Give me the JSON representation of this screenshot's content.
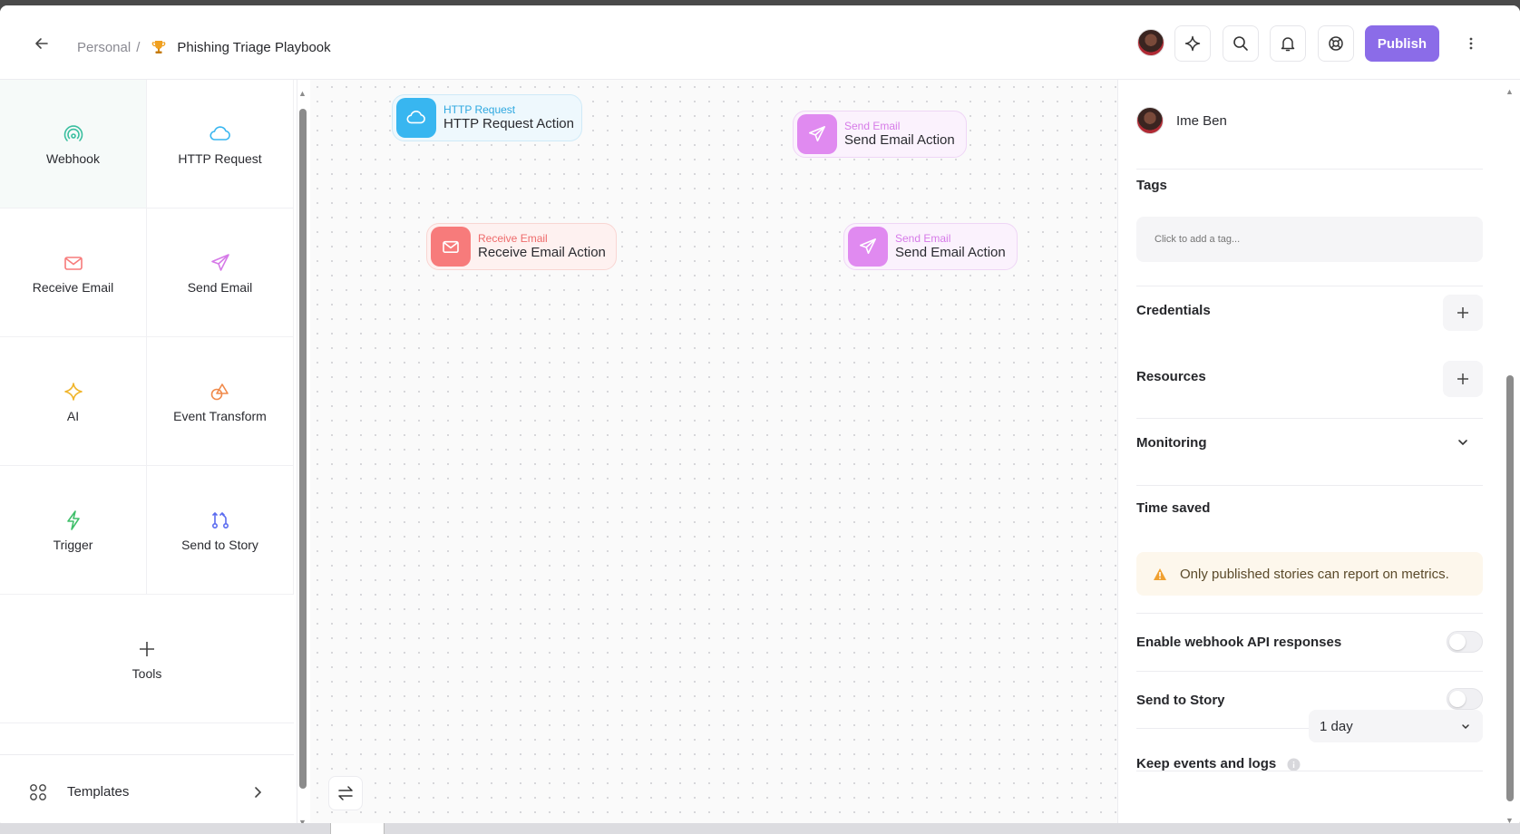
{
  "topbar": {
    "breadcrumb_root": "Personal",
    "breadcrumb_sep": "/",
    "story_title": "Phishing Triage Playbook",
    "publish_label": "Publish"
  },
  "palette": {
    "tiles": [
      {
        "label": "Webhook",
        "icon": "webhook-icon",
        "color": "#3bbfa0"
      },
      {
        "label": "HTTP Request",
        "icon": "cloud-icon",
        "color": "#38b6f0"
      },
      {
        "label": "Receive Email",
        "icon": "mail-icon",
        "color": "#f77b7b"
      },
      {
        "label": "Send Email",
        "icon": "paper-plane-icon",
        "color": "#d67ae8"
      },
      {
        "label": "AI",
        "icon": "sparkle-icon",
        "color": "#f0b429"
      },
      {
        "label": "Event Transform",
        "icon": "shapes-icon",
        "color": "#f08a4b"
      },
      {
        "label": "Trigger",
        "icon": "lightning-icon",
        "color": "#3fbf6a"
      },
      {
        "label": "Send to Story",
        "icon": "branch-icon",
        "color": "#5b6cf0"
      },
      {
        "label": "Tools",
        "icon": "plus-icon",
        "color": "#444444"
      }
    ],
    "templates_label": "Templates"
  },
  "canvas": {
    "nodes": [
      {
        "kind": "http",
        "type": "HTTP Request",
        "name": "HTTP Request Action"
      },
      {
        "kind": "send",
        "type": "Send Email",
        "name": "Send Email Action"
      },
      {
        "kind": "recv",
        "type": "Receive Email",
        "name": "Receive Email Action"
      },
      {
        "kind": "send",
        "type": "Send Email",
        "name": "Send Email Action"
      }
    ]
  },
  "settings": {
    "owner_name": "Ime Ben",
    "tags_title": "Tags",
    "tags_placeholder": "Click to add a tag...",
    "credentials_title": "Credentials",
    "resources_title": "Resources",
    "monitoring_title": "Monitoring",
    "time_saved_title": "Time saved",
    "time_saved_warning": "Only published stories can report on metrics.",
    "webhook_api_title": "Enable webhook API responses",
    "webhook_api_enabled": false,
    "send_to_story_title": "Send to Story",
    "send_to_story_enabled": false,
    "keep_events_title": "Keep events and logs",
    "keep_events_value": "1 day"
  }
}
